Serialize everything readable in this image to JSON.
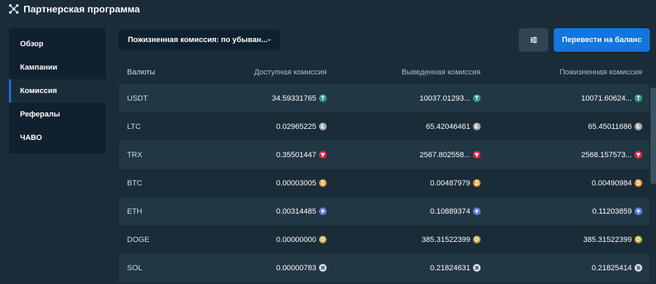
{
  "app": {
    "title": "Партнерская программа"
  },
  "sidebar": {
    "items": [
      {
        "label": "Обзор",
        "active": false
      },
      {
        "label": "Кампании",
        "active": false
      },
      {
        "label": "Комиссия",
        "active": true
      },
      {
        "label": "Рефералы",
        "active": false
      },
      {
        "label": "ЧАВО",
        "active": false
      }
    ]
  },
  "toolbar": {
    "sort_label": "Пожизненная комиссия: по убыван...",
    "transfer_label": "Перевести на баланс"
  },
  "table": {
    "headers": [
      "Валюты",
      "Доступная комиссия",
      "Выведенная комиссия",
      "Пожизненная комиссия"
    ],
    "rows": [
      {
        "currency": "USDT",
        "available": "34.59331765",
        "withdrawn": "10037.01293...",
        "lifetime": "10071.60624...",
        "icon": "usdt-icon",
        "color": "#26a17b",
        "glyph": "T"
      },
      {
        "currency": "LTC",
        "available": "0.02965225",
        "withdrawn": "65.42046461",
        "lifetime": "65.45011686",
        "icon": "ltc-icon",
        "color": "#a6a9aa",
        "glyph": "Ł"
      },
      {
        "currency": "TRX",
        "available": "0.35501447",
        "withdrawn": "2567.802558...",
        "lifetime": "2568.157573...",
        "icon": "trx-icon",
        "color": "#e5253d",
        "glyph": "▼"
      },
      {
        "currency": "BTC",
        "available": "0.00003005",
        "withdrawn": "0.00487979",
        "lifetime": "0.00490984",
        "icon": "btc-icon",
        "color": "#f7931a",
        "glyph": "₿"
      },
      {
        "currency": "ETH",
        "available": "0.00314485",
        "withdrawn": "0.10889374",
        "lifetime": "0.11203859",
        "icon": "eth-icon",
        "color": "#627eea",
        "glyph": "♦"
      },
      {
        "currency": "DOGE",
        "available": "0.00000000",
        "withdrawn": "385.31522399",
        "lifetime": "385.31522399",
        "icon": "doge-icon",
        "color": "#c2a633",
        "glyph": "D"
      },
      {
        "currency": "SOL",
        "available": "0.00000783",
        "withdrawn": "0.21824631",
        "lifetime": "0.21825414",
        "icon": "sol-icon",
        "color": "#d5dceb",
        "glyph": "≡"
      }
    ]
  }
}
